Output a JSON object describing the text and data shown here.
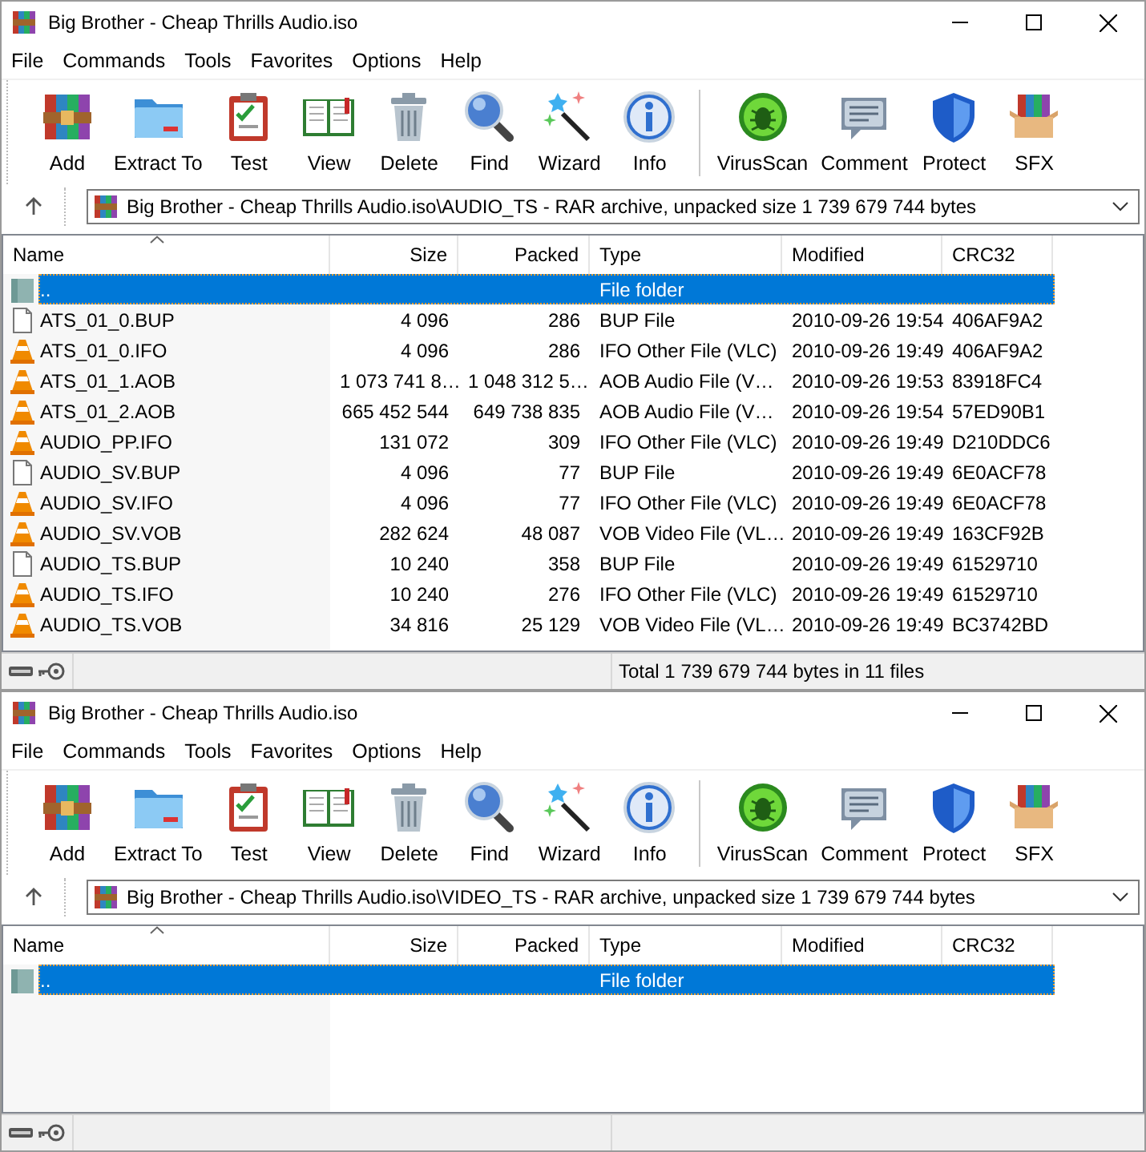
{
  "windows": [
    {
      "title": "Big Brother - Cheap Thrills Audio.iso",
      "menu": [
        "File",
        "Commands",
        "Tools",
        "Favorites",
        "Options",
        "Help"
      ],
      "toolbar": {
        "groups": [
          [
            "Add",
            "Extract To",
            "Test",
            "View",
            "Delete",
            "Find",
            "Wizard",
            "Info"
          ],
          [
            "VirusScan",
            "Comment",
            "Protect",
            "SFX"
          ]
        ]
      },
      "address": "Big Brother - Cheap Thrills Audio.iso\\AUDIO_TS - RAR archive, unpacked size 1 739 679 744 bytes",
      "columns": [
        {
          "label": "Name",
          "sorted": true
        },
        {
          "label": "Size",
          "sorted": false
        },
        {
          "label": "Packed",
          "sorted": false
        },
        {
          "label": "Type",
          "sorted": false
        },
        {
          "label": "Modified",
          "sorted": false
        },
        {
          "label": "CRC32",
          "sorted": false
        }
      ],
      "rows": [
        {
          "kind": "parent",
          "selected": true,
          "cells": [
            "..",
            "",
            "",
            "File folder",
            "",
            ""
          ]
        },
        {
          "kind": "document",
          "selected": false,
          "cells": [
            "ATS_01_0.BUP",
            "4 096",
            "286",
            "BUP File",
            "2010-09-26 19:54",
            "406AF9A2"
          ]
        },
        {
          "kind": "media",
          "selected": false,
          "cells": [
            "ATS_01_0.IFO",
            "4 096",
            "286",
            "IFO Other File (VLC)",
            "2010-09-26 19:49",
            "406AF9A2"
          ]
        },
        {
          "kind": "media",
          "selected": false,
          "cells": [
            "ATS_01_1.AOB",
            "1 073 741 8…",
            "1 048 312 5…",
            "AOB Audio File (V…",
            "2010-09-26 19:53",
            "83918FC4"
          ]
        },
        {
          "kind": "media",
          "selected": false,
          "cells": [
            "ATS_01_2.AOB",
            "665 452 544",
            "649 738 835",
            "AOB Audio File (V…",
            "2010-09-26 19:54",
            "57ED90B1"
          ]
        },
        {
          "kind": "media",
          "selected": false,
          "cells": [
            "AUDIO_PP.IFO",
            "131 072",
            "309",
            "IFO Other File (VLC)",
            "2010-09-26 19:49",
            "D210DDC6"
          ]
        },
        {
          "kind": "document",
          "selected": false,
          "cells": [
            "AUDIO_SV.BUP",
            "4 096",
            "77",
            "BUP File",
            "2010-09-26 19:49",
            "6E0ACF78"
          ]
        },
        {
          "kind": "media",
          "selected": false,
          "cells": [
            "AUDIO_SV.IFO",
            "4 096",
            "77",
            "IFO Other File (VLC)",
            "2010-09-26 19:49",
            "6E0ACF78"
          ]
        },
        {
          "kind": "media",
          "selected": false,
          "cells": [
            "AUDIO_SV.VOB",
            "282 624",
            "48 087",
            "VOB Video File (VL…",
            "2010-09-26 19:49",
            "163CF92B"
          ]
        },
        {
          "kind": "document",
          "selected": false,
          "cells": [
            "AUDIO_TS.BUP",
            "10 240",
            "358",
            "BUP File",
            "2010-09-26 19:49",
            "61529710"
          ]
        },
        {
          "kind": "media",
          "selected": false,
          "cells": [
            "AUDIO_TS.IFO",
            "10 240",
            "276",
            "IFO Other File (VLC)",
            "2010-09-26 19:49",
            "61529710"
          ]
        },
        {
          "kind": "media",
          "selected": false,
          "cells": [
            "AUDIO_TS.VOB",
            "34 816",
            "25 129",
            "VOB Video File (VL…",
            "2010-09-26 19:49",
            "BC3742BD"
          ]
        }
      ],
      "status": "Total 1 739 679 744 bytes in 11 files"
    },
    {
      "title": "Big Brother - Cheap Thrills Audio.iso",
      "menu": [
        "File",
        "Commands",
        "Tools",
        "Favorites",
        "Options",
        "Help"
      ],
      "toolbar": {
        "groups": [
          [
            "Add",
            "Extract To",
            "Test",
            "View",
            "Delete",
            "Find",
            "Wizard",
            "Info"
          ],
          [
            "VirusScan",
            "Comment",
            "Protect",
            "SFX"
          ]
        ]
      },
      "address": "Big Brother - Cheap Thrills Audio.iso\\VIDEO_TS - RAR archive, unpacked size 1 739 679 744 bytes",
      "columns": [
        {
          "label": "Name",
          "sorted": true
        },
        {
          "label": "Size",
          "sorted": false
        },
        {
          "label": "Packed",
          "sorted": false
        },
        {
          "label": "Type",
          "sorted": false
        },
        {
          "label": "Modified",
          "sorted": false
        },
        {
          "label": "CRC32",
          "sorted": false
        }
      ],
      "rows": [
        {
          "kind": "parent",
          "selected": true,
          "cells": [
            "..",
            "",
            "",
            "File folder",
            "",
            ""
          ]
        }
      ]
    }
  ]
}
